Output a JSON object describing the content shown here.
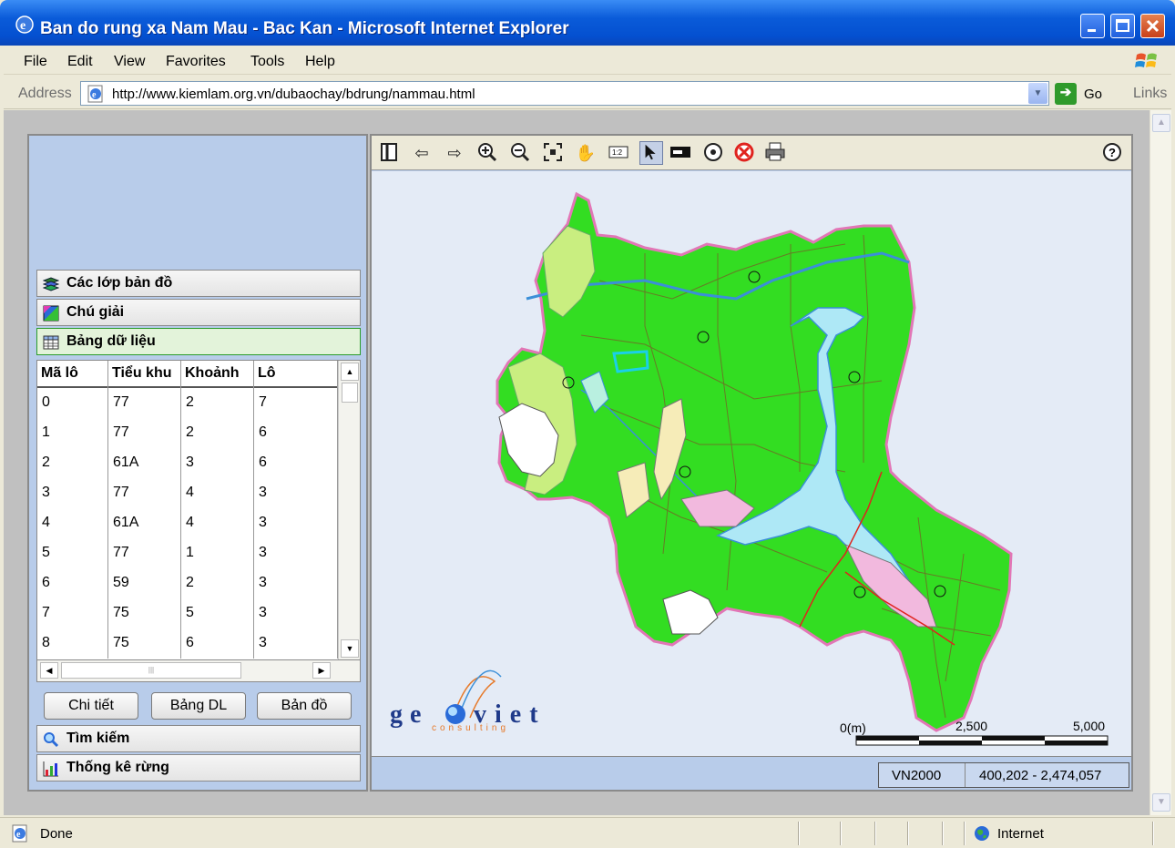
{
  "window": {
    "title": "Ban do rung xa Nam Mau - Bac Kan - Microsoft Internet Explorer"
  },
  "menu": [
    "File",
    "Edit",
    "View",
    "Favorites",
    "Tools",
    "Help"
  ],
  "address": {
    "label": "Address",
    "url": "http://www.kiemlam.org.vn/dubaochay/bdrung/nammau.html",
    "go_label": "Go",
    "links_label": "Links"
  },
  "left_panel": {
    "sections": {
      "layers": "Các lớp bản đồ",
      "legend": "Chú giải",
      "data_table": "Bảng dữ liệu",
      "search": "Tìm kiếm",
      "stats": "Thống kê rừng"
    },
    "table": {
      "columns": [
        "Mã lô",
        "Tiểu khu",
        "Khoảnh",
        "Lô"
      ],
      "rows": [
        [
          "0",
          "77",
          "2",
          "7"
        ],
        [
          "1",
          "77",
          "2",
          "6"
        ],
        [
          "2",
          "61A",
          "3",
          "6"
        ],
        [
          "3",
          "77",
          "4",
          "3"
        ],
        [
          "4",
          "61A",
          "4",
          "3"
        ],
        [
          "5",
          "77",
          "1",
          "3"
        ],
        [
          "6",
          "59",
          "2",
          "3"
        ],
        [
          "7",
          "75",
          "5",
          "3"
        ],
        [
          "8",
          "75",
          "6",
          "3"
        ]
      ]
    },
    "buttons": {
      "detail": "Chi tiết",
      "table": "Bảng DL",
      "map": "Bản đồ"
    }
  },
  "map": {
    "toolbar_icons": [
      "layout-icon",
      "back-icon",
      "forward-icon",
      "zoom-in-icon",
      "zoom-out-icon",
      "full-extent-icon",
      "pan-icon",
      "scale-icon",
      "select-icon",
      "identify-icon",
      "buffer-icon",
      "clear-icon",
      "print-icon"
    ],
    "help_label": "?",
    "logo_text": "geoviet",
    "logo_sub": "consulting",
    "scale": {
      "label0": "0(m)",
      "label1": "2,500",
      "label2": "5,000"
    },
    "projection": "VN2000",
    "coordinates": "400,202 - 2,474,057",
    "colors": {
      "forest": "#33dd22",
      "water": "#aee8f6",
      "light_green": "#c9ee80",
      "boundary": "#e276b6",
      "canvas": "#e4ebf6"
    }
  },
  "status": {
    "text": "Done",
    "zone": "Internet"
  }
}
